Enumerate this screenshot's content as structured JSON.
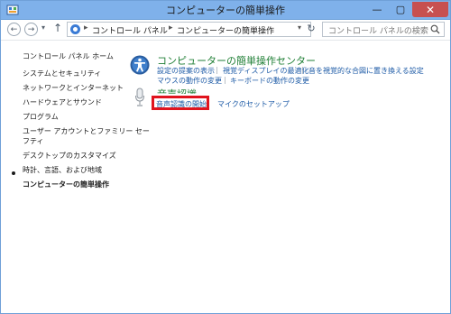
{
  "window": {
    "title": "コンピューターの簡単操作"
  },
  "titlebar": {
    "minimize": "—",
    "maximize": "▢",
    "close": "✕"
  },
  "nav": {
    "back": "←",
    "forward": "→",
    "up": "↑",
    "dropdown": "▾",
    "refresh": "↻"
  },
  "breadcrumb": {
    "items": [
      "コントロール パネル",
      "コンピューターの簡単操作"
    ],
    "separator": "▸"
  },
  "search": {
    "placeholder": "コントロール パネルの検索"
  },
  "sidebar": {
    "items": [
      "コントロール パネル ホーム",
      "システムとセキュリティ",
      "ネットワークとインターネット",
      "ハードウェアとサウンド",
      "プログラム",
      "ユーザー アカウントとファミリー セー",
      "フティ",
      "デスクトップのカスタマイズ",
      "時計、言語、および地域",
      "コンピューターの簡単操作"
    ]
  },
  "main": {
    "section_title": "コンピューターの簡単操作センター",
    "links_row1": [
      "設定の提案の表示",
      "視覚ディスプレイの最適化",
      "音を視覚的な合図に置き換える設定"
    ],
    "links_row2": [
      "マウスの動作の変更",
      "キーボードの動作の変更"
    ],
    "speech_title": "音声認識",
    "speech_links": [
      "音声認識の開始",
      "マイクのセットアップ"
    ],
    "link_separator": "|"
  },
  "colors": {
    "titlebar": "#7fb1ea",
    "section_title": "#1e7e34",
    "link": "#1c5aa6",
    "highlight": "#e0141e",
    "close": "#c75050"
  }
}
